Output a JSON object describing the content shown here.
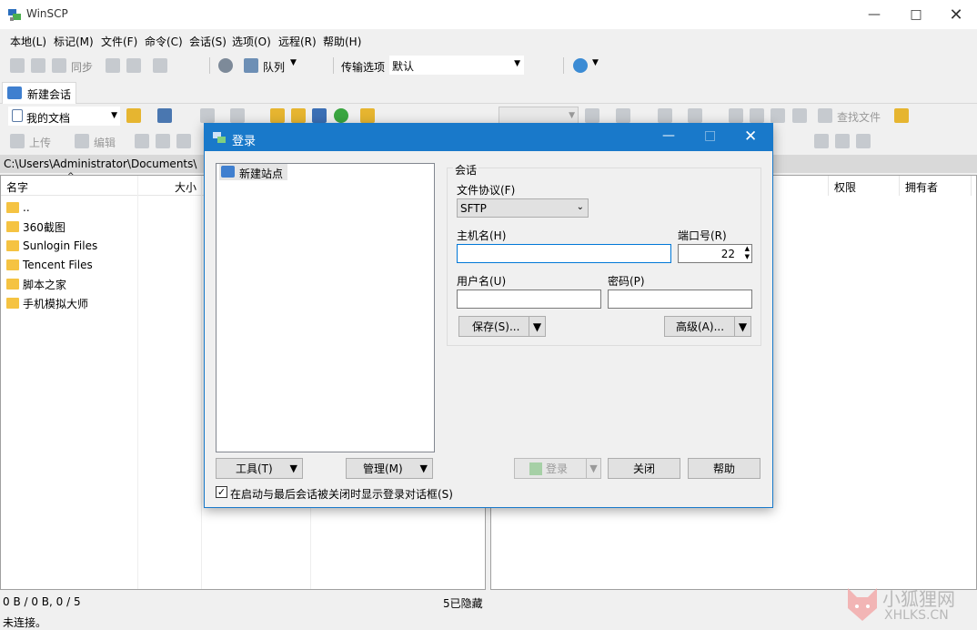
{
  "window": {
    "title": "WinSCP",
    "minimize_icon": "minimize-icon",
    "maximize_icon": "maximize-icon",
    "close_icon": "close-icon"
  },
  "menu": [
    "本地(L)",
    "标记(M)",
    "文件(F)",
    "命令(C)",
    "会话(S)",
    "选项(O)",
    "远程(R)",
    "帮助(H)"
  ],
  "toolbar1": {
    "sync_label": "同步",
    "queue_label": "队列",
    "transfer_label": "传输选项",
    "transfer_value": "默认"
  },
  "session_tab": {
    "label": "新建会话"
  },
  "left_toolbar": {
    "location": "我的文档",
    "upload_label": "上传",
    "edit_label": "编辑"
  },
  "right_toolbar": {
    "find_label": "查找文件"
  },
  "left_panel": {
    "path": "C:\\Users\\Administrator\\Documents\\",
    "columns": [
      "名字",
      "大小"
    ],
    "rows": [
      "..",
      "360截图",
      "Sunlogin Files",
      "Tencent Files",
      "脚本之家",
      "手机模拟大师"
    ]
  },
  "right_panel": {
    "columns": [
      "权限",
      "拥有者"
    ]
  },
  "status": {
    "left": "0 B / 0 B,  0 / 5",
    "hidden": "5已隐藏",
    "connection": "未连接。"
  },
  "dialog": {
    "title": "登录",
    "site_item": "新建站点",
    "group_label": "会话",
    "protocol_label": "文件协议(F)",
    "protocol_value": "SFTP",
    "host_label": "主机名(H)",
    "host_value": "",
    "port_label": "端口号(R)",
    "port_value": "22",
    "user_label": "用户名(U)",
    "user_value": "",
    "password_label": "密码(P)",
    "password_value": "",
    "save_button": "保存(S)...",
    "advanced_button": "高级(A)...",
    "tools_button": "工具(T)",
    "manage_button": "管理(M)",
    "login_button": "登录",
    "close_button": "关闭",
    "help_button": "帮助",
    "checkbox_label": "在启动与最后会话被关闭时显示登录对话框(S)",
    "checkbox_checked": true
  },
  "watermark": {
    "line1": "小狐狸网",
    "line2": "XHLKS.CN"
  }
}
